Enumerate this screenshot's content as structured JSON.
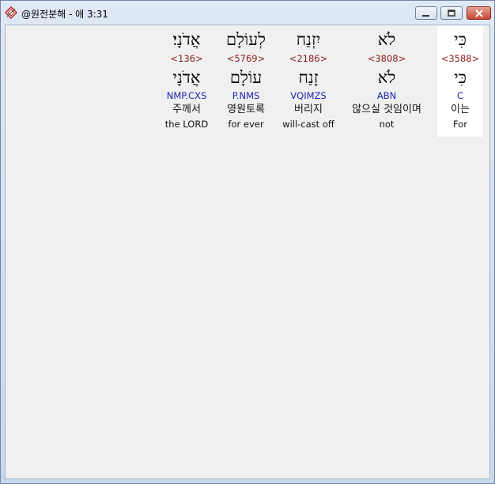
{
  "window": {
    "title": "@원전분해 - 애 3:31"
  },
  "colors": {
    "strong_number": "#8b1c1c",
    "parsing": "#1a24b0",
    "selected_background": "#ffffff",
    "client_background": "#f0f0f0"
  },
  "icons": {
    "app": "diamond-app-icon",
    "minimize": "minimize-icon",
    "maximize": "maximize-icon",
    "close": "close-icon"
  },
  "words": [
    {
      "hebrew": "כִּי",
      "strong": "<3588>",
      "lemma": "כִּי",
      "parsing": "C",
      "korean": "이는",
      "english": "For",
      "selected": true
    },
    {
      "hebrew": "לֹא",
      "strong": "<3808>",
      "lemma": "לֹא",
      "parsing": "ABN",
      "korean": "않으실 것임이며",
      "english": "not",
      "selected": false
    },
    {
      "hebrew": "יִזְנַח",
      "strong": "<2186>",
      "lemma": "זָנַח",
      "parsing": "VQIMZS",
      "korean": "버리지",
      "english": "will-cast off",
      "selected": false
    },
    {
      "hebrew": "לְעוֹלָם",
      "strong": "<5769>",
      "lemma": "עוֹלָם",
      "parsing": "P.NMS",
      "korean": "영원토록",
      "english": "for ever",
      "selected": false
    },
    {
      "hebrew": "אֲדֹנָי׃",
      "strong": "<136>",
      "lemma": "אֲדֹנָי",
      "parsing": "NMP.CXS",
      "korean": "주께서",
      "english": "the LORD",
      "selected": false
    }
  ]
}
